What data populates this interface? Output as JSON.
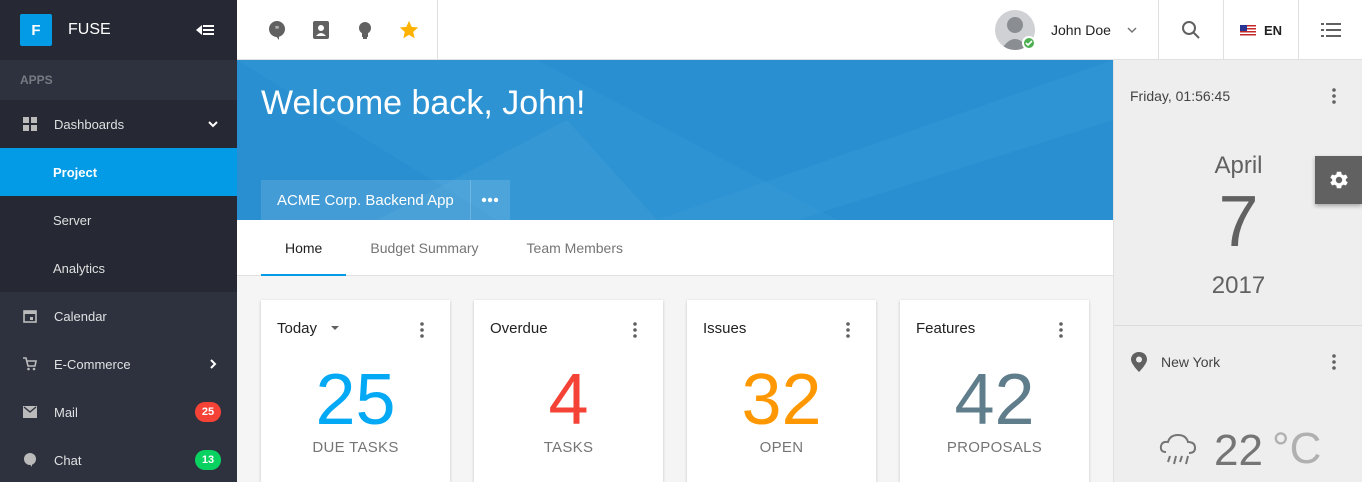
{
  "sidebar": {
    "logo_letter": "F",
    "logo_text": "FUSE",
    "group_label": "APPS",
    "dashboards_label": "Dashboards",
    "sub_items": [
      "Project",
      "Server",
      "Analytics"
    ],
    "calendar_label": "Calendar",
    "ecommerce_label": "E-Commerce",
    "mail_label": "Mail",
    "mail_badge": "25",
    "chat_label": "Chat",
    "chat_badge": "13"
  },
  "topbar": {
    "user_name": "John Doe",
    "language": "EN"
  },
  "header": {
    "welcome": "Welcome back, John!",
    "project_name": "ACME Corp. Backend App"
  },
  "tabs": [
    "Home",
    "Budget Summary",
    "Team Members"
  ],
  "widgets": [
    {
      "title": "Today",
      "value": "25",
      "label": "DUE TASKS",
      "color": "#03a9f4"
    },
    {
      "title": "Overdue",
      "value": "4",
      "label": "TASKS",
      "color": "#f44336"
    },
    {
      "title": "Issues",
      "value": "32",
      "label": "OPEN",
      "color": "#ff9800"
    },
    {
      "title": "Features",
      "value": "42",
      "label": "PROPOSALS",
      "color": "#607d8b"
    }
  ],
  "right_panel": {
    "datetime": "Friday, 01:56:45",
    "month": "April",
    "day": "7",
    "year": "2017",
    "city": "New York",
    "temperature": "22",
    "unit": "°C"
  },
  "colors": {
    "accent": "#039be5",
    "sidebar_bg": "#2d323e",
    "hero_bg": "#2a8fd0",
    "mail_badge": "#f44336",
    "chat_badge": "#09d261"
  }
}
